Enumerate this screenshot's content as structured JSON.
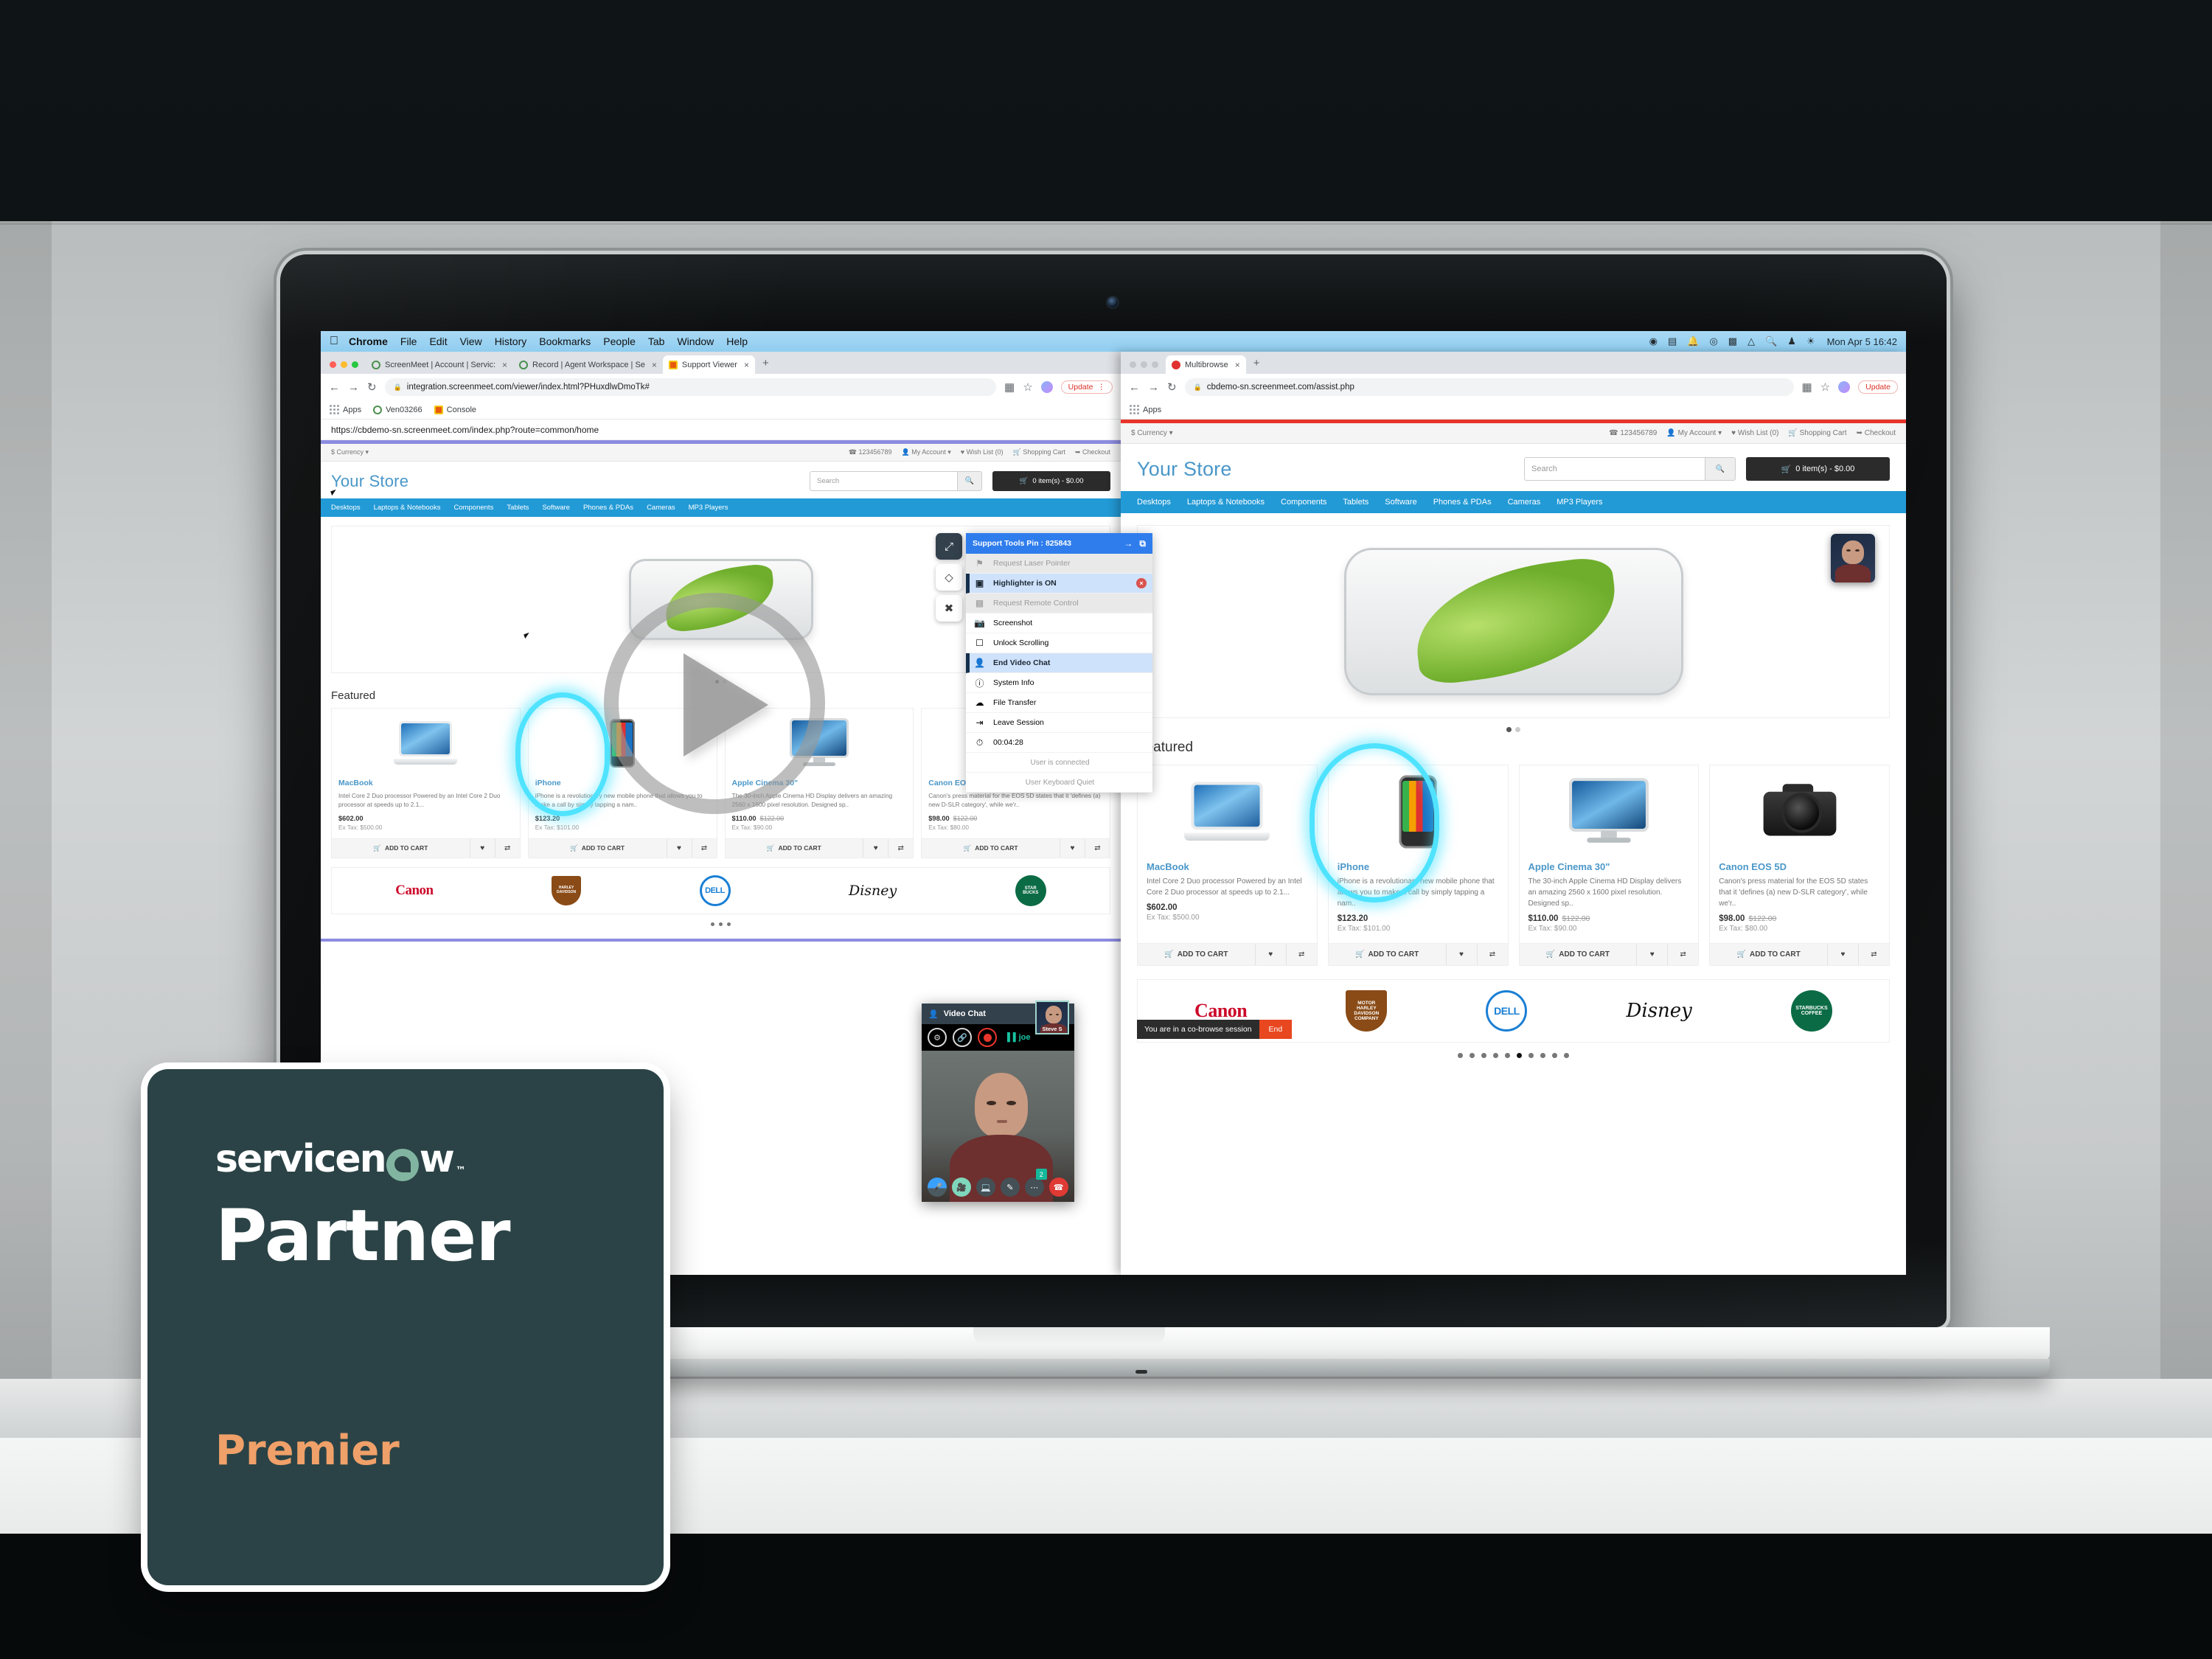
{
  "macbar": {
    "apple": "",
    "menus": [
      "Chrome",
      "File",
      "Edit",
      "View",
      "History",
      "Bookmarks",
      "People",
      "Tab",
      "Window",
      "Help"
    ],
    "status_icons": [
      "dropbox-icon",
      "battery-icon",
      "bell-icon",
      "record-icon",
      "keyboard-icon",
      "wifi-icon",
      "search-icon",
      "user-icon",
      "siri-icon"
    ],
    "clock": "Mon Apr 5  16:42"
  },
  "left_window": {
    "tabs": [
      {
        "label": "ScreenMeet | Account | Servic:",
        "favicon": "screenmeet-icon",
        "active": false,
        "close": "×"
      },
      {
        "label": "Record | Agent Workspace | Se",
        "favicon": "screenmeet-icon",
        "active": false,
        "close": "×"
      },
      {
        "label": "Support Viewer",
        "favicon": "console-icon",
        "active": true,
        "close": "×"
      }
    ],
    "new_tab": "+",
    "nav": {
      "back": "←",
      "forward": "→",
      "reload": "↻"
    },
    "url": "integration.screenmeet.com/viewer/index.html?PHuxdlwDmoTk#",
    "lock": "🔒",
    "update_label": "Update",
    "menu_dots": "⋮",
    "bookmarks": [
      "Apps",
      "Ven03266",
      "Console"
    ],
    "viewed_url": "https://cbdemo-sn.screenmeet.com/index.php?route=common/home"
  },
  "right_window": {
    "tabs": [
      {
        "label": "Multibrowse",
        "favicon": "multibrowse-icon",
        "active": true,
        "close": "×"
      }
    ],
    "new_tab": "+",
    "url": "cbdemo-sn.screenmeet.com/assist.php",
    "update_label": "Update",
    "bookmarks": [
      "Apps"
    ]
  },
  "store": {
    "topbar": {
      "currency": "$ Currency",
      "links": [
        "123456789",
        "My Account",
        "Wish List (0)",
        "Shopping Cart",
        "Checkout"
      ]
    },
    "logo": "Your Store",
    "search_placeholder": "Search",
    "search_icon": "magnifier-icon",
    "cart_label": "0 item(s) - $0.00",
    "nav": [
      "Desktops",
      "Laptops & Notebooks",
      "Components",
      "Tablets",
      "Software",
      "Phones & PDAs",
      "Cameras",
      "MP3 Players"
    ],
    "featured_title": "Featured",
    "products": [
      {
        "name": "MacBook",
        "desc": "Intel Core 2 Duo processor Powered by an Intel Core 2 Duo processor at speeds up to 2.1...",
        "price": "$602.00",
        "old_price": "",
        "tax": "Ex Tax: $500.00",
        "art": "laptop-art",
        "add_to_cart": "ADD TO CART"
      },
      {
        "name": "iPhone",
        "desc": "iPhone is a revolutionary new mobile phone that allows you to make a call by simply tapping a nam..",
        "price": "$123.20",
        "old_price": "",
        "tax": "Ex Tax: $101.00",
        "art": "phone-art",
        "add_to_cart": "ADD TO CART"
      },
      {
        "name": "Apple Cinema 30\"",
        "desc": "The 30-inch Apple Cinema HD Display delivers an amazing 2560 x 1600 pixel resolution. Designed sp..",
        "price": "$110.00",
        "old_price": "$122.00",
        "tax": "Ex Tax: $90.00",
        "art": "monitor-art",
        "add_to_cart": "ADD TO CART"
      },
      {
        "name": "Canon EOS 5D",
        "desc": "Canon's press material for the EOS 5D states that it 'defines (a) new D-SLR category', while we'r..",
        "price": "$98.00",
        "old_price": "$122.00",
        "tax": "Ex Tax: $80.00",
        "art": "cam-art",
        "add_to_cart": "ADD TO CART"
      }
    ],
    "wishlist_icon": "heart-icon",
    "compare_icon": "compare-icon",
    "brands": [
      "Canon",
      "Harley Davidson",
      "Dell",
      "Disney",
      "Starbucks"
    ],
    "carousel_dots": 2,
    "carousel_active": 0,
    "footer_dots": 10,
    "footer_active": 5
  },
  "support_tools": {
    "title": "Support Tools Pin : 825843",
    "expand_icon": "arrow-right-icon",
    "popout_icon": "popout-icon",
    "items": [
      {
        "label": "Request Laser Pointer",
        "icon": "laser-pointer-icon",
        "state": "disabled"
      },
      {
        "label": "Highlighter is ON",
        "icon": "highlighter-icon",
        "state": "selected",
        "badge": "×"
      },
      {
        "label": "Request Remote Control",
        "icon": "remote-control-icon",
        "state": "disabled"
      },
      {
        "label": "Screenshot",
        "icon": "camera-icon",
        "state": "normal"
      },
      {
        "label": "Unlock Scrolling",
        "icon": "scroll-lock-icon",
        "state": "normal"
      },
      {
        "label": "End Video Chat",
        "icon": "person-video-icon",
        "state": "selected"
      },
      {
        "label": "System Info",
        "icon": "info-icon",
        "state": "normal"
      },
      {
        "label": "File Transfer",
        "icon": "file-transfer-icon",
        "state": "normal"
      },
      {
        "label": "Leave Session",
        "icon": "exit-icon",
        "state": "normal"
      },
      {
        "label": "00:04:28",
        "icon": "clock-icon",
        "state": "normal"
      }
    ],
    "notes": [
      "User is connected",
      "User Keyboard Quiet"
    ],
    "float_buttons": [
      "popout-icon",
      "eraser-icon",
      "clear-icon"
    ]
  },
  "video_chat": {
    "title": "Video Chat",
    "close": "×",
    "settings_icon": "gear-icon",
    "link_icon": "link-icon",
    "record_icon": "record-icon",
    "speaker_name": "joe",
    "pip_name": "Steve S",
    "controls": [
      "mic-icon",
      "camera-icon",
      "screen-share-icon",
      "draw-icon",
      "more-icon",
      "hangup-icon"
    ],
    "notification_count": "2"
  },
  "cobrowse_banner": {
    "message": "You are in a co-browse session",
    "end_label": "End"
  },
  "partner_badge": {
    "brand": "servicenow",
    "trademark": "™",
    "title": "Partner",
    "tier": "Premier",
    "bg_color": "#2b4346",
    "tier_color": "#f0a069",
    "accent_color": "#81b5a1"
  },
  "play_overlay": {
    "label": "play-button"
  },
  "colors": {
    "store_blue": "#229ad6",
    "logo_blue": "#4a97c9",
    "highlighter": "#4fe3ff",
    "tools_header": "#2f7ded",
    "cobrowse_end": "#e8471f"
  }
}
